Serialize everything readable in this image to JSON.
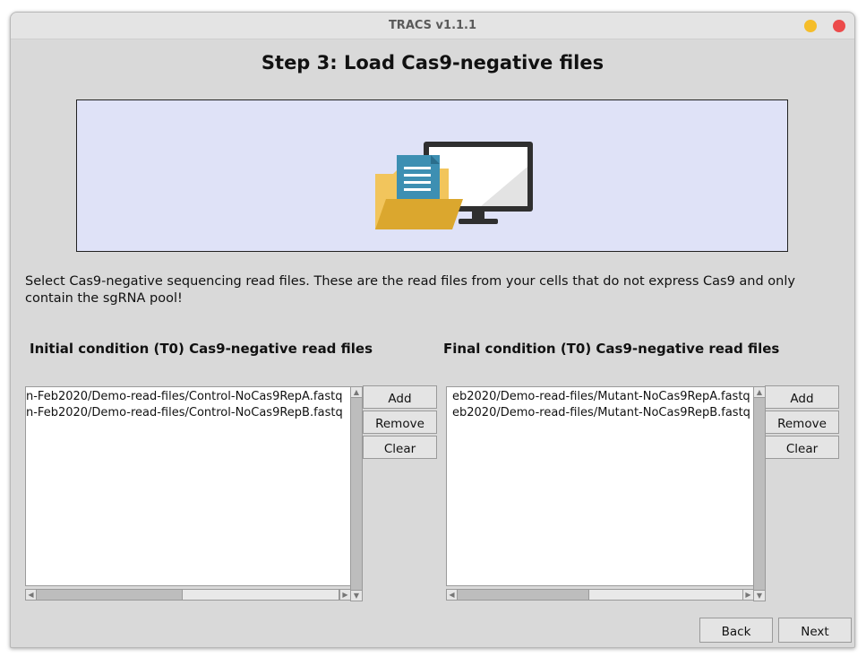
{
  "window": {
    "title": "TRACS v1.1.1"
  },
  "step_title": "Step 3: Load Cas9-negative files",
  "banner": {
    "icon": "folder-document-monitor-illustration"
  },
  "description": "Select Cas9-negative sequencing read files. These are the read files from your cells that do not express Cas9 and only contain the sgRNA pool!",
  "initial": {
    "label": "Initial condition (T0) Cas9-negative read files",
    "files": [
      "n-Feb2020/Demo-read-files/Control-NoCas9RepA.fastq",
      "n-Feb2020/Demo-read-files/Control-NoCas9RepB.fastq"
    ],
    "add_label": "Add",
    "remove_label": "Remove",
    "clear_label": "Clear"
  },
  "final": {
    "label": "Final condition (T0) Cas9-negative read files",
    "files": [
      "eb2020/Demo-read-files/Mutant-NoCas9RepA.fastq",
      "eb2020/Demo-read-files/Mutant-NoCas9RepB.fastq"
    ],
    "add_label": "Add",
    "remove_label": "Remove",
    "clear_label": "Clear"
  },
  "nav": {
    "back_label": "Back",
    "next_label": "Next"
  },
  "colors": {
    "window_bg": "#d9d9d9",
    "banner_bg": "#dfe2f7",
    "minimize": "#f5bd2a",
    "close": "#ec4b4b"
  }
}
